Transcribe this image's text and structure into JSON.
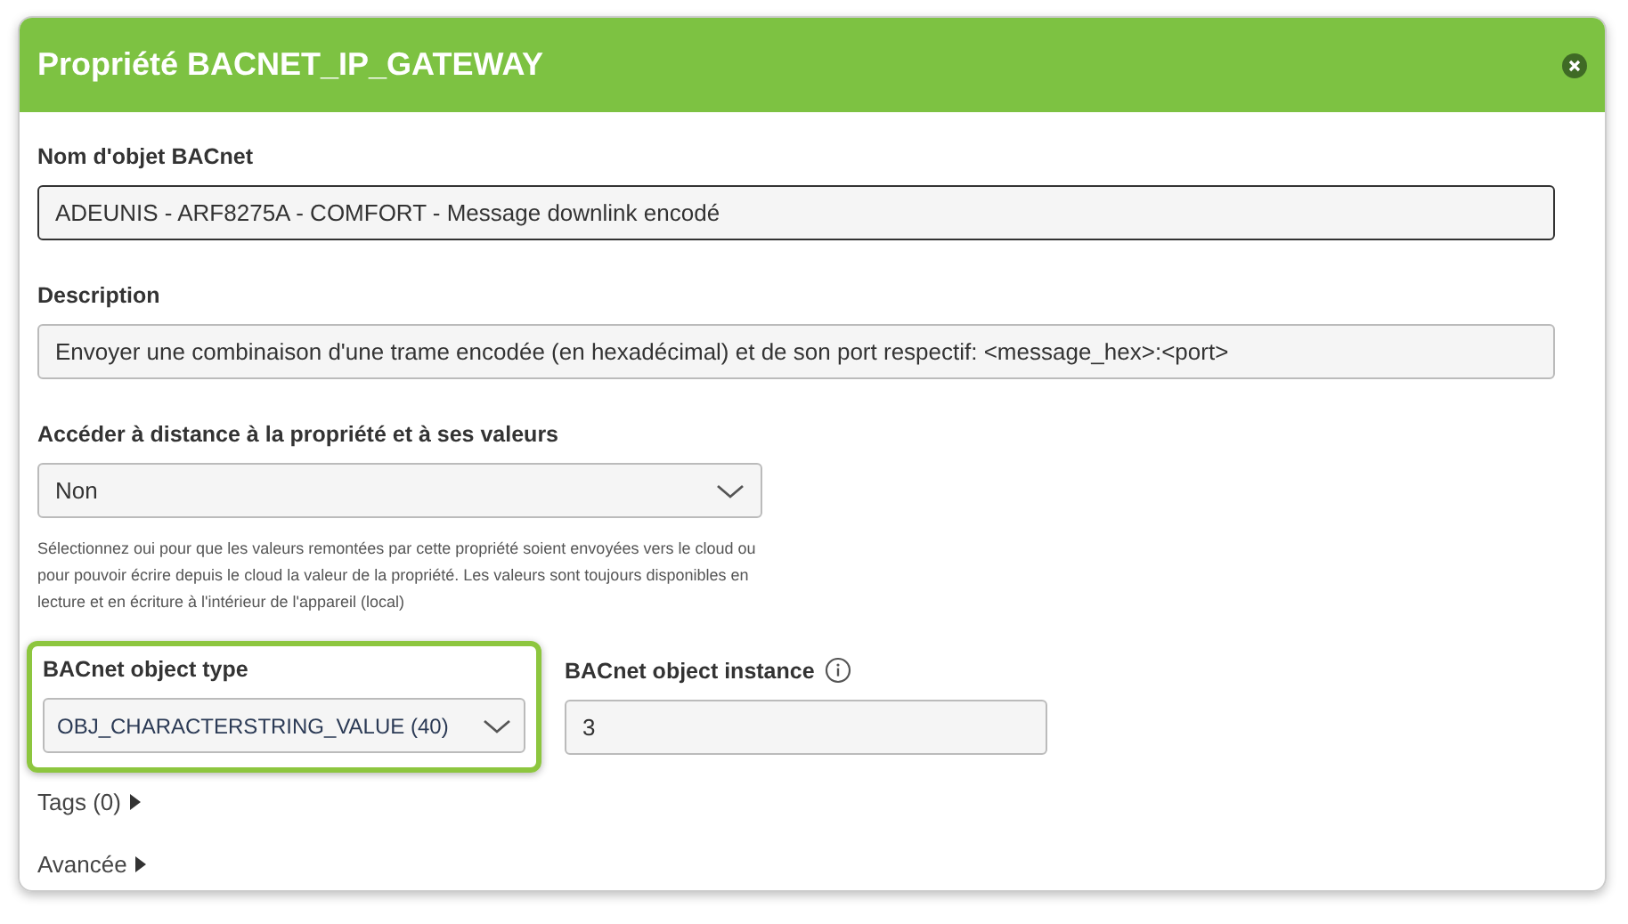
{
  "dialog": {
    "title": "Propriété BACNET_IP_GATEWAY"
  },
  "fields": [
    {
      "kind": "text",
      "label": "Nom d'objet BACnet",
      "value": "ADEUNIS - ARF8275A - COMFORT - Message downlink encodé",
      "focused": true
    },
    {
      "kind": "text",
      "label": "Description",
      "value": "Envoyer une combinaison d'une trame encodée (en hexadécimal) et de son port respectif: <message_hex>:<port>",
      "focused": false
    },
    {
      "kind": "select",
      "label": "Accéder à distance à la propriété et à ses valeurs",
      "value": "Non",
      "help": "Sélectionnez oui pour que les valeurs remontées par cette propriété soient envoyées vers le cloud ou pour pouvoir écrire depuis le cloud la valeur de la propriété. Les valeurs sont toujours disponibles en lecture et en écriture à l'intérieur de l'appareil (local)"
    }
  ],
  "bacnet": [
    {
      "kind": "select",
      "label": "BACnet object type",
      "value": "OBJ_CHARACTERSTRING_VALUE (40)",
      "highlighted": true,
      "info": false
    },
    {
      "kind": "text",
      "label": "BACnet object instance",
      "value": "3",
      "highlighted": false,
      "info": true
    }
  ],
  "sections": [
    {
      "label": "Tags (0)",
      "expanded": false
    },
    {
      "label": "Avancée",
      "expanded": false
    }
  ]
}
